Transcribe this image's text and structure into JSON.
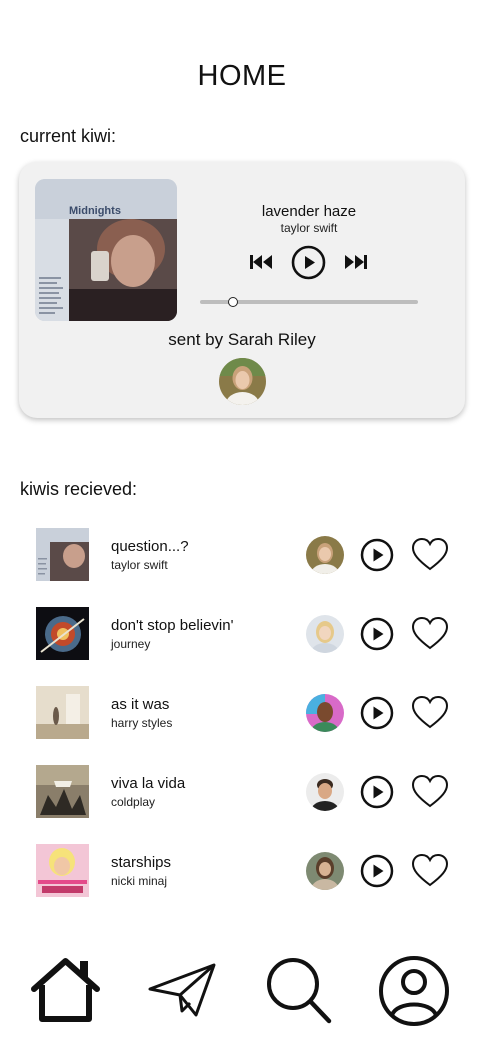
{
  "page": {
    "title": "HOME"
  },
  "current": {
    "section_label": "current kiwi:",
    "song": "lavender haze",
    "artist": "taylor swift",
    "album_cover_text": "Midnights",
    "progress": 0.15,
    "sent_by": "sent by Sarah Riley"
  },
  "received": {
    "section_label": "kiwis recieved:",
    "items": [
      {
        "title": "question...?",
        "artist": "taylor swift"
      },
      {
        "title": "don't stop believin'",
        "artist": "journey"
      },
      {
        "title": "as it was",
        "artist": "harry styles"
      },
      {
        "title": "viva la vida",
        "artist": "coldplay"
      },
      {
        "title": "starships",
        "artist": "nicki minaj"
      }
    ]
  },
  "nav": {
    "items": [
      {
        "icon": "home-icon"
      },
      {
        "icon": "send-icon"
      },
      {
        "icon": "search-icon"
      },
      {
        "icon": "profile-icon"
      }
    ]
  },
  "colors": {
    "card_bg": "#f1f1f1",
    "track": "#bdbdbd",
    "text": "#111111"
  }
}
